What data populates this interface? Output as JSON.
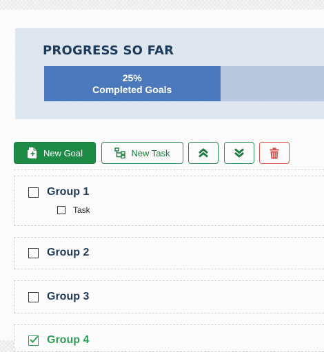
{
  "progress": {
    "title": "PROGRESS SO FAR",
    "percent_label": "25%",
    "caption": "Completed Goals",
    "fraction": 0.25
  },
  "toolbar": {
    "new_goal_label": "New Goal",
    "new_task_label": "New Task",
    "icons": {
      "new_goal": "add-file-icon",
      "new_task": "hierarchy-icon",
      "expand": "double-chevron-up-icon",
      "collapse": "double-chevron-down-icon",
      "delete": "trash-icon"
    }
  },
  "groups": [
    {
      "label": "Group 1",
      "checked": false,
      "tasks": [
        {
          "label": "Task",
          "checked": false
        }
      ]
    },
    {
      "label": "Group 2",
      "checked": false,
      "tasks": []
    },
    {
      "label": "Group 3",
      "checked": false,
      "tasks": []
    },
    {
      "label": "Group 4",
      "checked": true,
      "tasks": []
    }
  ],
  "colors": {
    "primary_green": "#1d8a46",
    "progress_fill": "#4b79bb",
    "progress_track": "#b7c8df",
    "title_navy": "#1f3b5c",
    "danger_red": "#d9534f",
    "done_green": "#2ea05a"
  }
}
